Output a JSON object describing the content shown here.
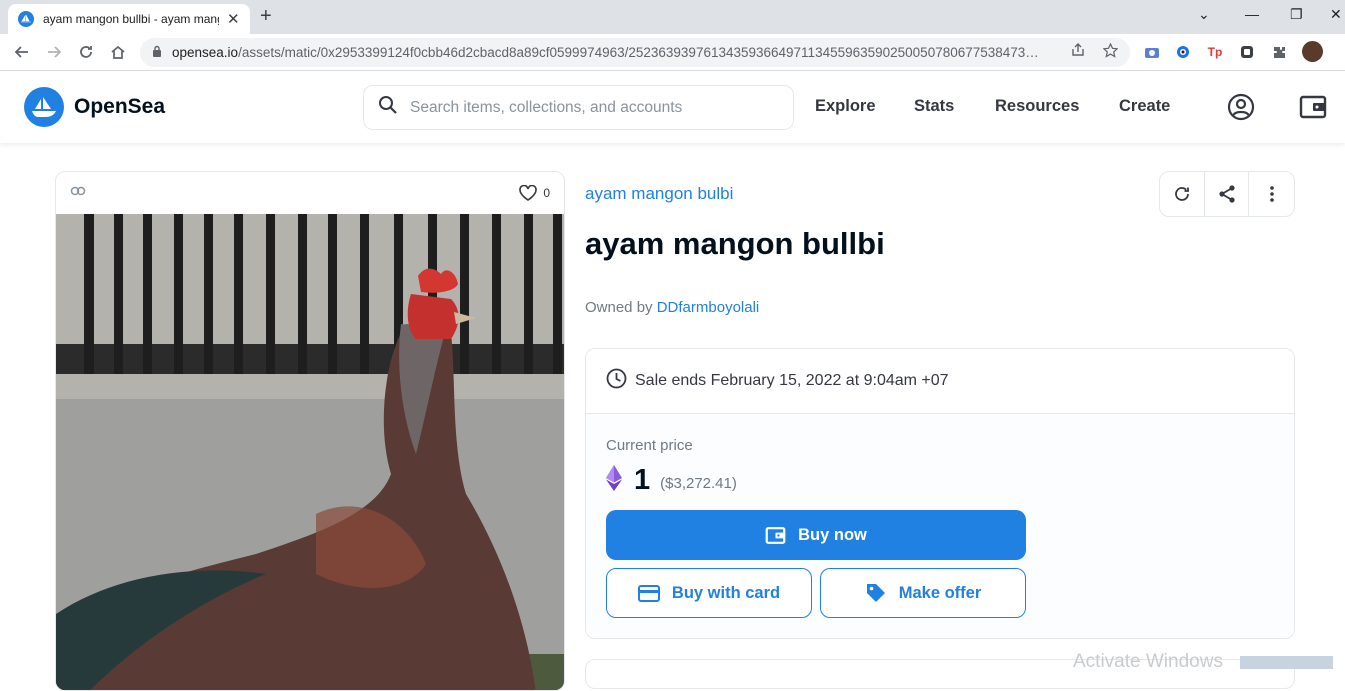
{
  "browser": {
    "tab_title": "ayam mangon bullbi - ayam mangon bulbi | OpenSea",
    "url_host": "opensea.io",
    "url_path": "/assets/matic/0x2953399124f0cbb46d2cbacd8a89cf0599974963/25236393976134359366497113455963590250050780677538473…"
  },
  "header": {
    "logo_text": "OpenSea",
    "search_placeholder": "Search items, collections, and accounts",
    "nav": [
      "Explore",
      "Stats",
      "Resources",
      "Create"
    ]
  },
  "item": {
    "favorites_count": "0",
    "collection": "ayam mangon bulbi",
    "title": "ayam mangon bullbi",
    "owned_by_label": "Owned by",
    "owner": "DDfarmboyolali"
  },
  "listing": {
    "sale_ends": "Sale ends February 15, 2022 at 9:04am +07",
    "current_price_label": "Current price",
    "price_eth": "1",
    "price_usd": "($3,272.41)",
    "buy_now": "Buy now",
    "buy_with_card": "Buy with card",
    "make_offer": "Make offer"
  },
  "colors": {
    "brand_blue": "#2081e2",
    "text_dark": "#04111d",
    "text_muted": "#707a83"
  },
  "os_overlay": {
    "watermark": "Activate Windows"
  }
}
